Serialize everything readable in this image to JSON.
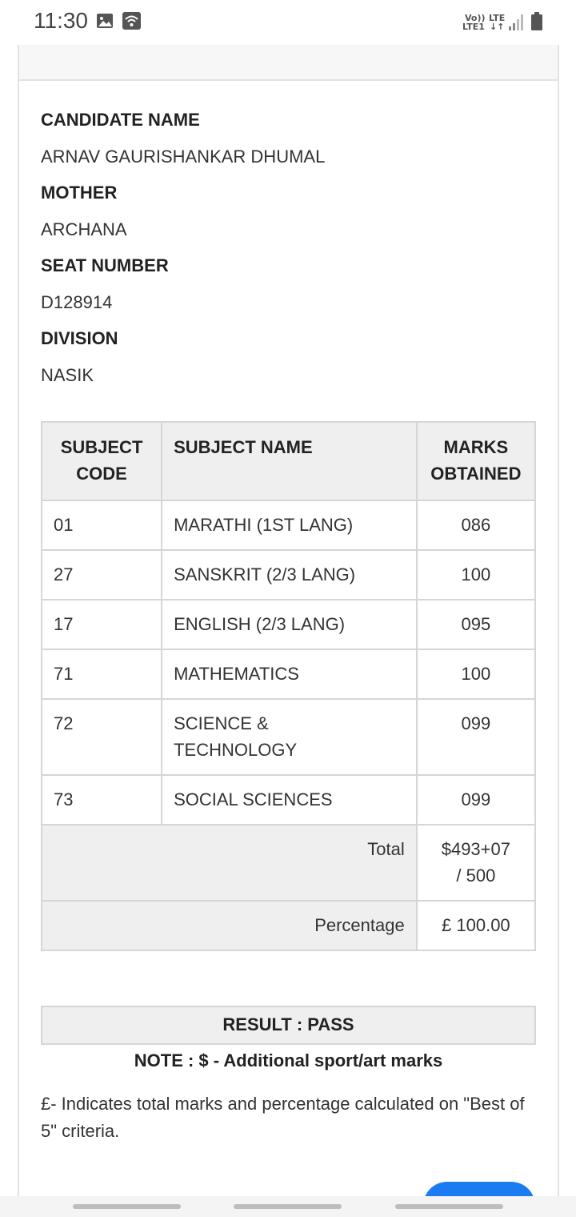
{
  "status_bar": {
    "time": "11:30",
    "image_icon": "image-icon",
    "wifi_icon": "wifi-icon",
    "volte_text": "Vo))",
    "lte1_text": "LTE1",
    "lte_text": "LTE",
    "arrows_text": "↓↑",
    "signal_icon": "signal-icon",
    "battery_icon": "battery-icon"
  },
  "candidate": {
    "name_label": "CANDIDATE NAME",
    "name_value": "ARNAV GAURISHANKAR DHUMAL",
    "mother_label": "MOTHER",
    "mother_value": "ARCHANA",
    "seat_label": "SEAT NUMBER",
    "seat_value": "D128914",
    "division_label": "DIVISION",
    "division_value": "NASIK"
  },
  "marks_table": {
    "headers": {
      "code_line1": "SUBJECT",
      "code_line2": "CODE",
      "name": "SUBJECT NAME",
      "marks_line1": "MARKS",
      "marks_line2": "OBTAINED"
    },
    "rows": [
      {
        "code": "01",
        "name": "MARATHI (1ST LANG)",
        "marks": "086"
      },
      {
        "code": "27",
        "name": "SANSKRIT (2/3 LANG)",
        "marks": "100"
      },
      {
        "code": "17",
        "name": "ENGLISH (2/3 LANG)",
        "marks": "095"
      },
      {
        "code": "71",
        "name": "MATHEMATICS",
        "marks": "100"
      },
      {
        "code": "72",
        "name": "SCIENCE & TECHNOLOGY",
        "marks": "099"
      },
      {
        "code": "73",
        "name": "SOCIAL SCIENCES",
        "marks": "099"
      }
    ],
    "total_label": "Total",
    "total_value": "$493+07 / 500",
    "percentage_label": "Percentage",
    "percentage_value": "£ 100.00"
  },
  "result": {
    "text": "RESULT : PASS",
    "note": "NOTE : $ - Additional sport/art marks",
    "footnote": "£- Indicates total marks and percentage calculated on \"Best of 5\" criteria."
  },
  "colors": {
    "fab": "#1a7cf0",
    "header_bg": "#efefef",
    "border": "#d6d6d6"
  }
}
